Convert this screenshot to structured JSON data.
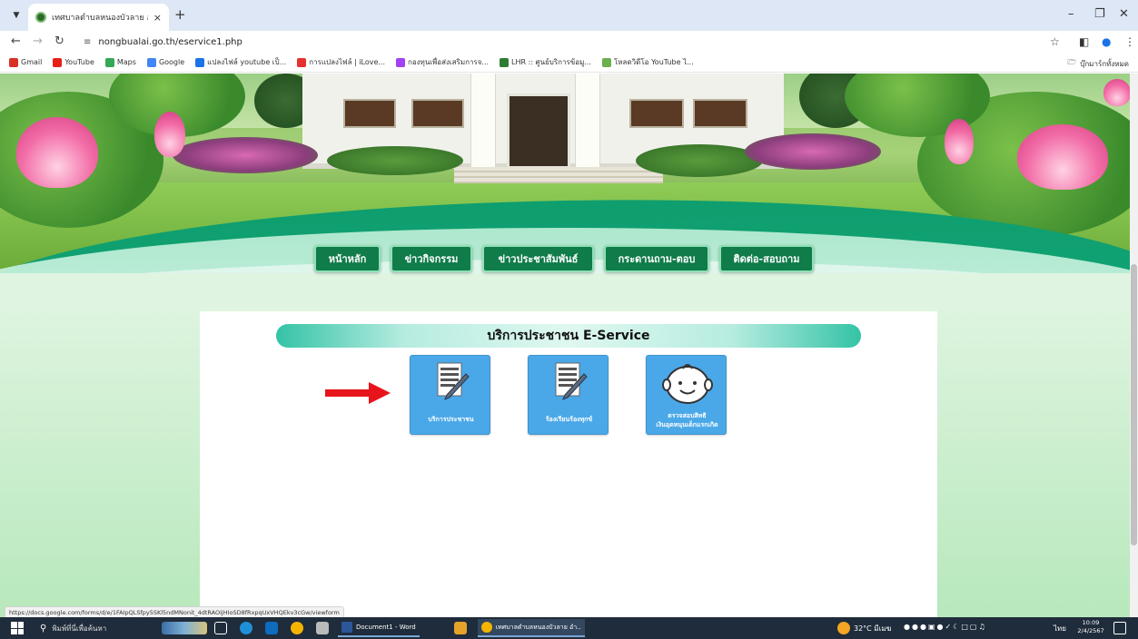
{
  "browser": {
    "tab_title": "เทศบาลตำบลหนองบัวลาย อำเภอบัวลาย จั...",
    "tab_close": "×",
    "new_tab": "+",
    "url": "nongbualai.go.th/eservice1.php",
    "bookmarks": [
      {
        "label": "Gmail",
        "color": "#d93025"
      },
      {
        "label": "YouTube",
        "color": "#e62117"
      },
      {
        "label": "Maps",
        "color": "#34a853"
      },
      {
        "label": "Google",
        "color": "#4285f4"
      },
      {
        "label": "แปลงไฟล์ youtube เป็...",
        "color": "#1a73e8"
      },
      {
        "label": "การแปลงไฟล์ | iLove...",
        "color": "#e5322d"
      },
      {
        "label": "กองทุนเพื่อส่งเสริมการจ...",
        "color": "#a142f4"
      },
      {
        "label": "LHR :: ศูนย์บริการข้อมู...",
        "color": "#2e7d32"
      },
      {
        "label": "โหลดวิดีโอ YouTube ไ...",
        "color": "#6ab04c"
      }
    ],
    "bookmarks_folder": "บุ๊กมาร์กทั้งหมด",
    "status_url": "https://docs.google.com/forms/d/e/1FAIpQLSfpy5SKl5ndMNonit_4dtRAOijHIoSD8fRxpqUxVHQEkv3cGw/viewform"
  },
  "site": {
    "nav": [
      {
        "label": "หน้าหลัก",
        "width": 73
      },
      {
        "label": "ข่าวกิจกรรม",
        "width": 90
      },
      {
        "label": "ข่าวประชาสัมพันธ์",
        "width": 123
      },
      {
        "label": "กระดานถาม-ตอบ",
        "width": 116
      },
      {
        "label": "ติดต่อ-สอบถาม",
        "width": 104
      }
    ],
    "section_title": "บริการประชาชน E-Service",
    "services": [
      {
        "label": "บริการประชาชน",
        "icon": "document-pen-icon"
      },
      {
        "label": "ร้องเรียนร้องทุกข์",
        "icon": "document-pen-icon"
      },
      {
        "label_line1": "ตรวจสอบสิทธิ",
        "label_line2": "เงินอุดหนุนเด็กแรกเกิด",
        "icon": "baby-face-icon"
      }
    ]
  },
  "taskbar": {
    "search_placeholder": "พิมพ์ที่นี่เพื่อค้นหา",
    "word_window": "Document1 - Word",
    "chrome_window": "เทศบาลตำบลหนองบัวลาย อำ...",
    "weather": "32°C มีเมฆ",
    "language": "ไทย",
    "time": "10:09",
    "date": "2/4/2567"
  },
  "colors": {
    "nav_bg": "#0f7c4a",
    "service_bg": "#4aa8e8",
    "arrow": "#e8141b"
  }
}
